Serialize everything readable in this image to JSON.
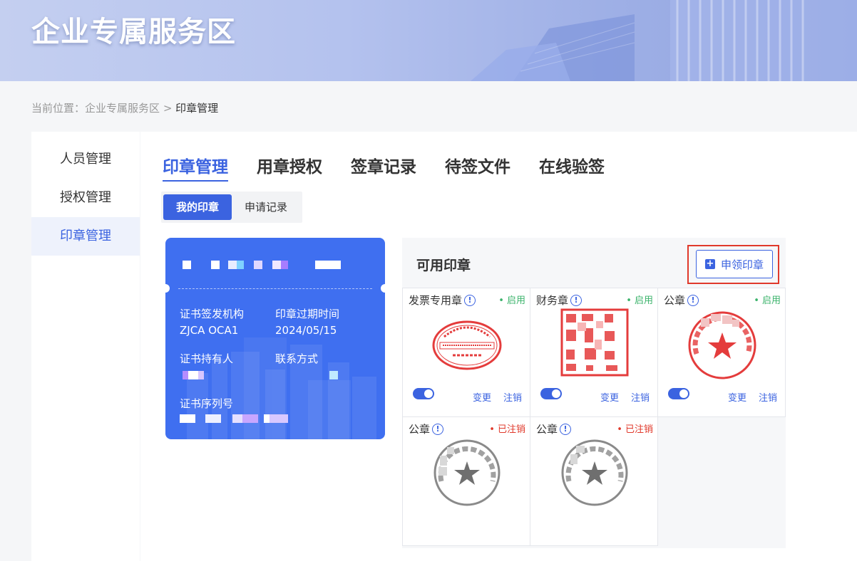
{
  "banner": {
    "title": "企业专属服务区"
  },
  "breadcrumb": {
    "prefix": "当前位置：",
    "parent": "企业专属服务区",
    "separator": ">",
    "current": "印章管理"
  },
  "sidebar": {
    "items": [
      {
        "label": "人员管理",
        "active": false
      },
      {
        "label": "授权管理",
        "active": false
      },
      {
        "label": "印章管理",
        "active": true
      }
    ]
  },
  "tabs": [
    {
      "label": "印章管理",
      "active": true
    },
    {
      "label": "用章授权",
      "active": false
    },
    {
      "label": "签章记录",
      "active": false
    },
    {
      "label": "待签文件",
      "active": false
    },
    {
      "label": "在线验签",
      "active": false
    }
  ],
  "subtabs": [
    {
      "label": "我的印章",
      "active": true
    },
    {
      "label": "申请记录",
      "active": false
    }
  ],
  "certificate": {
    "issuer_label": "证书签发机构",
    "issuer_value": "ZJCA OCA1",
    "expiry_label": "印章过期时间",
    "expiry_value": "2024/05/15",
    "holder_label": "证书持有人",
    "contact_label": "联系方式",
    "serial_label": "证书序列号"
  },
  "seals_panel": {
    "title": "可用印章",
    "apply_button": "申领印章",
    "seals": [
      {
        "name": "发票专用章",
        "status": "• 启用",
        "state": "enabled",
        "change": "变更",
        "cancel": "注销"
      },
      {
        "name": "财务章",
        "status": "• 启用",
        "state": "enabled",
        "change": "变更",
        "cancel": "注销"
      },
      {
        "name": "公章",
        "status": "• 启用",
        "state": "enabled",
        "change": "变更",
        "cancel": "注销"
      },
      {
        "name": "公章",
        "status": "• 已注销",
        "state": "revoked"
      },
      {
        "name": "公章",
        "status": "• 已注销",
        "state": "revoked"
      }
    ]
  },
  "colors": {
    "accent": "#3b63e0",
    "enabled": "#3bb36b",
    "revoked": "#e0392b",
    "stamp_red": "#e43c3c",
    "stamp_gray": "#8a8a8a"
  }
}
